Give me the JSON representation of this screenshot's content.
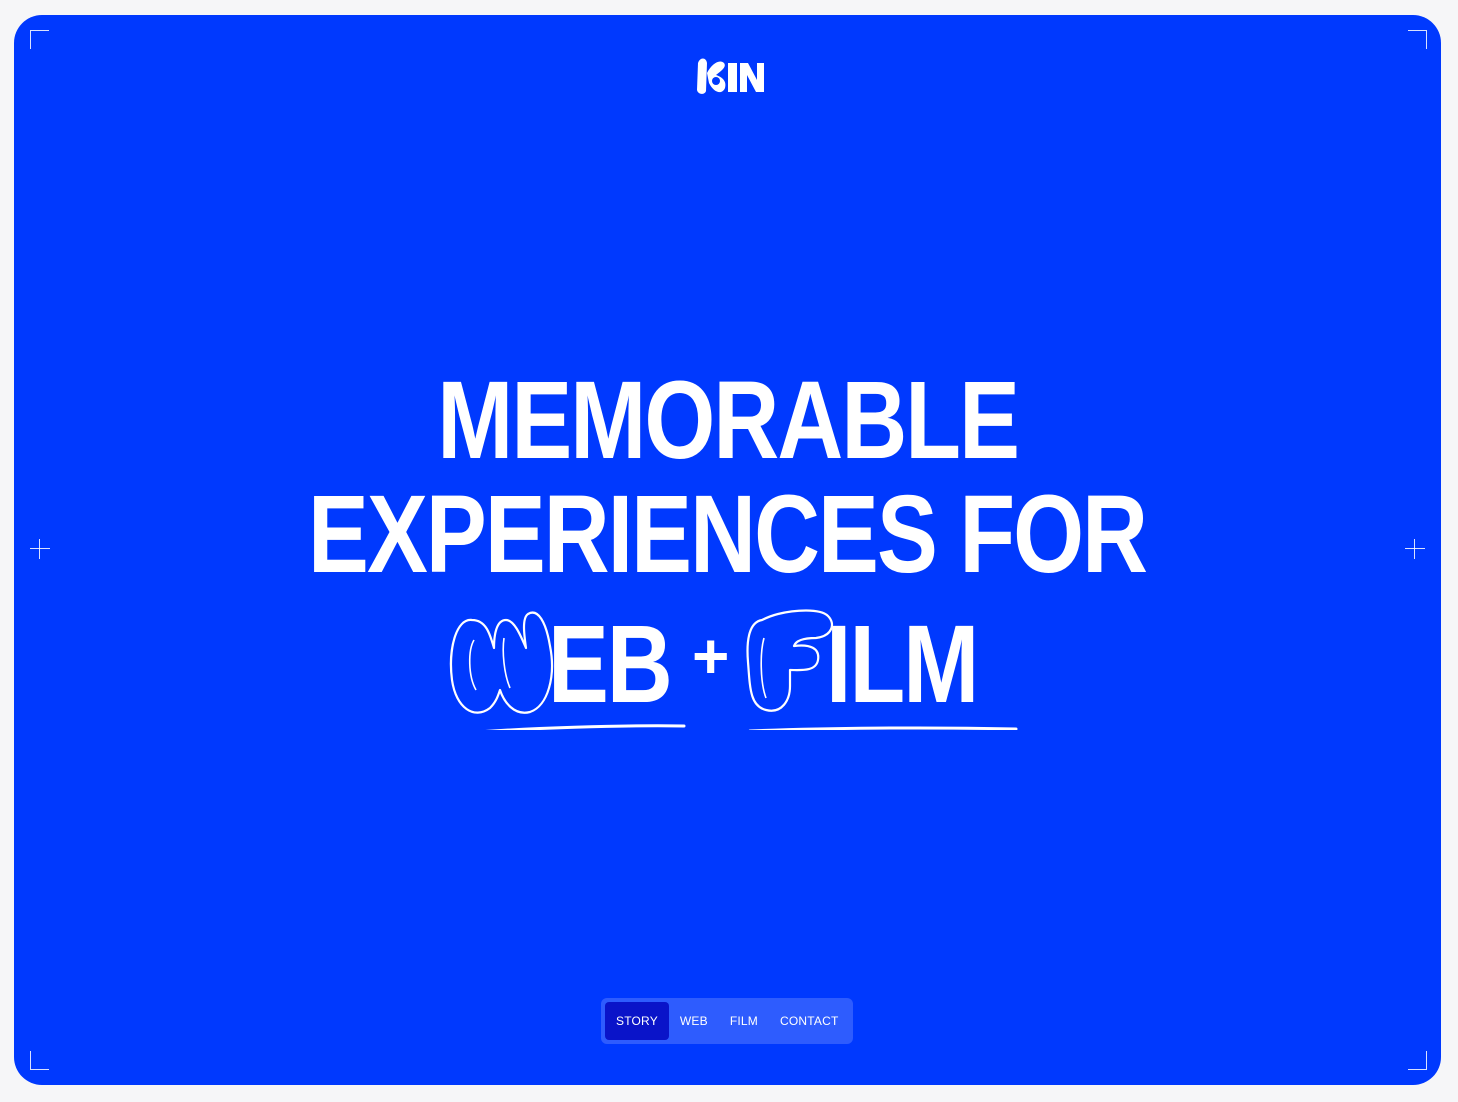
{
  "brand": {
    "logo_text": "KIN",
    "background_color": "#0039fe",
    "text_color": "#ffffff"
  },
  "hero": {
    "line1": "MEMORABLE",
    "line2": "EXPERIENCES FOR",
    "line3_web_initial": "W",
    "line3_web_rest": "EB",
    "line3_plus": "+",
    "line3_film_initial": "F",
    "line3_film_rest": "ILM"
  },
  "nav": {
    "items": [
      {
        "label": "STORY",
        "active": true
      },
      {
        "label": "WEB",
        "active": false
      },
      {
        "label": "FILM",
        "active": false
      },
      {
        "label": "CONTACT",
        "active": false
      }
    ]
  }
}
